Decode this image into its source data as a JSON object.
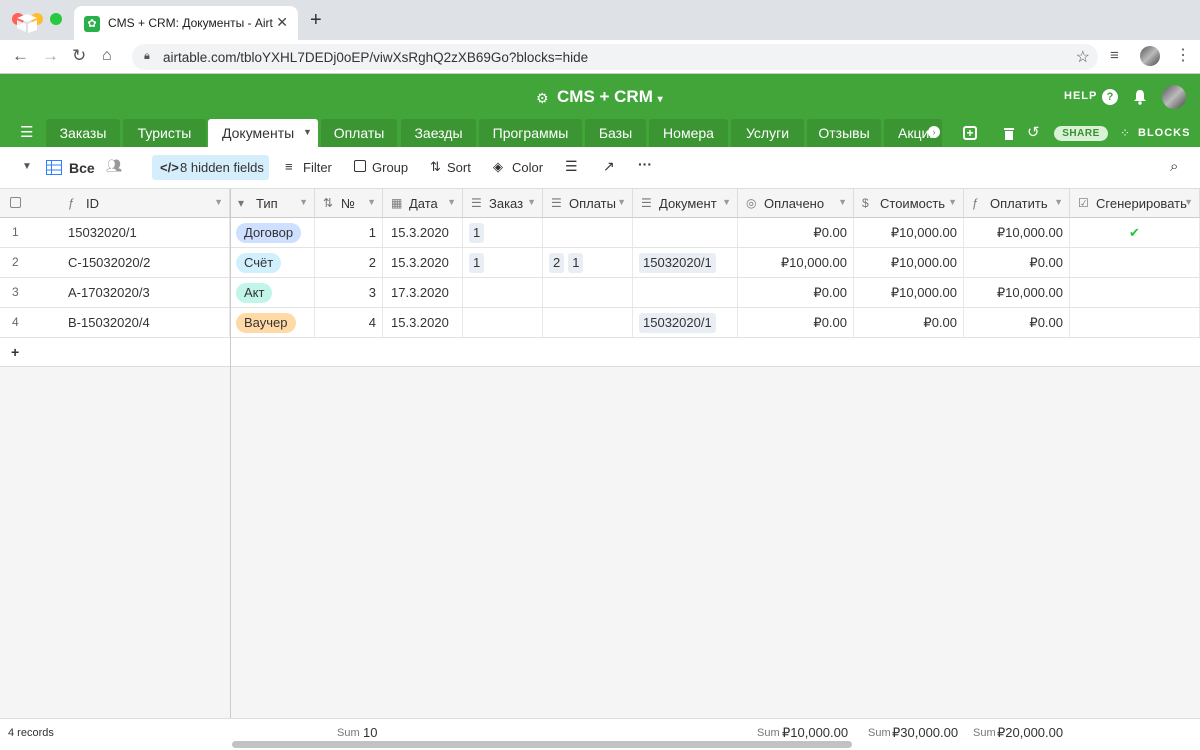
{
  "browser": {
    "tab_title": "CMS + CRM: Документы - Airtable",
    "url": "airtable.com/tbloYXHL7DEDj0oEP/viwXsRghQ2zXB69Go?blocks=hide"
  },
  "app": {
    "base_title": "CMS + CRM",
    "help_label": "HELP",
    "share_label": "SHARE",
    "blocks_label": "BLOCKS",
    "brand_color": "#41a53a"
  },
  "tables": [
    "Заказы",
    "Туристы",
    "Документы",
    "Оплаты",
    "Заезды",
    "Программы",
    "Базы",
    "Номера",
    "Услуги",
    "Отзывы",
    "Акции"
  ],
  "active_table": "Документы",
  "viewbar": {
    "view_name": "Все",
    "hidden_fields": "8 hidden fields",
    "filter": "Filter",
    "group": "Group",
    "sort": "Sort",
    "color": "Color"
  },
  "columns": [
    "ID",
    "Тип",
    "№",
    "Дата",
    "Заказ",
    "Оплаты",
    "Документ",
    "Оплачено",
    "Стоимость",
    "Оплатить",
    "Сгенерировать"
  ],
  "rows": [
    {
      "n": "1",
      "id": "15032020/1",
      "type": "Договор",
      "type_color": "#cfdfff",
      "num": "1",
      "date": "15.3.2020",
      "order": [
        "1"
      ],
      "payments": [],
      "doc": [],
      "paid": "₽0.00",
      "cost": "₽10,000.00",
      "topay": "₽10,000.00",
      "generated": true
    },
    {
      "n": "2",
      "id": "C-15032020/2",
      "type": "Счёт",
      "type_color": "#d0f0fd",
      "num": "2",
      "date": "15.3.2020",
      "order": [
        "1"
      ],
      "payments": [
        "2",
        "1"
      ],
      "doc": [
        "15032020/1"
      ],
      "paid": "₽10,000.00",
      "cost": "₽10,000.00",
      "topay": "₽0.00",
      "generated": false
    },
    {
      "n": "3",
      "id": "A-17032020/3",
      "type": "Акт",
      "type_color": "#c2f5e9",
      "num": "3",
      "date": "17.3.2020",
      "order": [],
      "payments": [],
      "doc": [],
      "paid": "₽0.00",
      "cost": "₽10,000.00",
      "topay": "₽10,000.00",
      "generated": false
    },
    {
      "n": "4",
      "id": "B-15032020/4",
      "type": "Ваучер",
      "type_color": "#ffdaa6",
      "num": "4",
      "date": "15.3.2020",
      "order": [],
      "payments": [],
      "doc": [
        "15032020/1"
      ],
      "paid": "₽0.00",
      "cost": "₽0.00",
      "topay": "₽0.00",
      "generated": false
    }
  ],
  "add_row": "+",
  "footer": {
    "records": "4 records",
    "sum_label": "Sum",
    "sum_num": "10",
    "sum_paid": "₽10,000.00",
    "sum_cost": "₽30,000.00",
    "sum_topay": "₽20,000.00"
  }
}
